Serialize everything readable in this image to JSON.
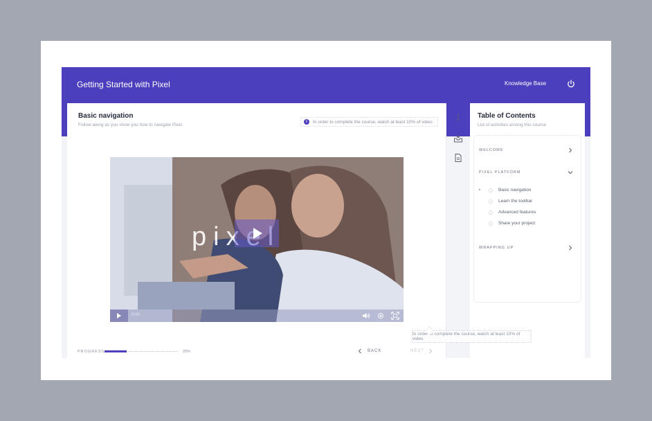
{
  "header": {
    "app_title": "Getting Started with Pixel",
    "knowledge_base_label": "Knowledge Base",
    "power_icon": "power-icon"
  },
  "lesson": {
    "title": "Basic navigation",
    "subtitle": "Follow along as you show you how to navigate Pixel.",
    "notice": "In order to complete the course, watch at least 10% of video"
  },
  "video": {
    "watermark": "pixel",
    "time": "0:00",
    "icons": [
      "play-icon",
      "volume-icon",
      "settings-icon",
      "fullscreen-icon"
    ]
  },
  "footer": {
    "progress_label": "PROGRESS",
    "progress_value": 0.2,
    "progress_text": "20%",
    "back_label": "BACK",
    "next_label": "NEXT",
    "tooltip": "In order to complete the course, watch at least 10% of video"
  },
  "toolstrip": [
    "info-icon",
    "inbox-icon",
    "document-icon"
  ],
  "toc": {
    "title": "Table of Contents",
    "subtitle": "List of activities among this course",
    "sections": [
      {
        "label": "WELCOME",
        "expanded": false
      },
      {
        "label": "PIXEL PLATFORM",
        "expanded": true,
        "items": [
          "Basic navigation",
          "Learn the toolbar",
          "Advanced features",
          "Share your project"
        ]
      },
      {
        "label": "WRAPPING UP",
        "expanded": false
      }
    ]
  },
  "colors": {
    "accent": "#4b3fbd",
    "background": "#a2a7b2",
    "card": "#ffffff"
  }
}
